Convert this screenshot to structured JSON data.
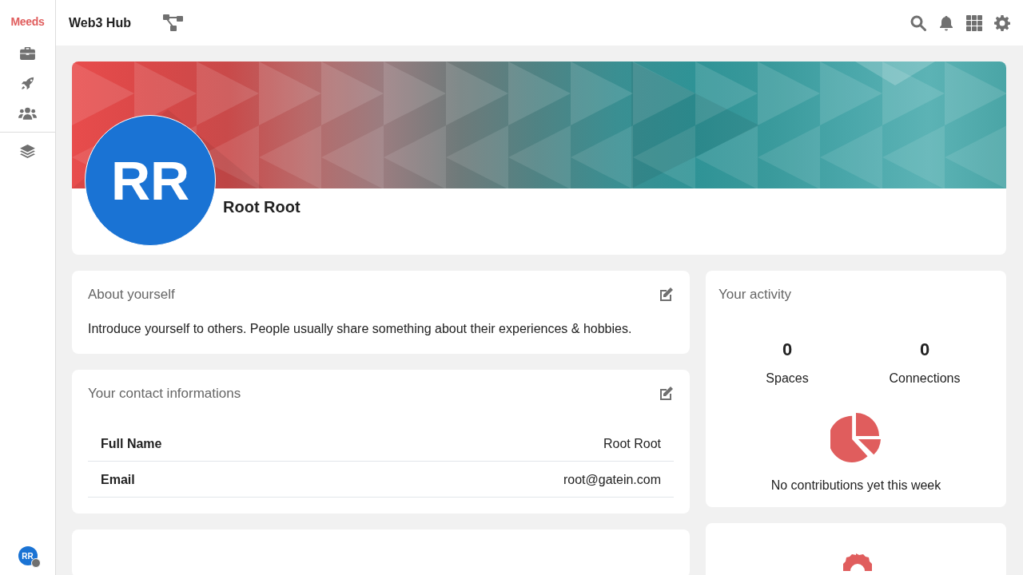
{
  "sidebar": {
    "logo": "Meeds",
    "avatar_initials": "RR"
  },
  "topbar": {
    "title": "Web3 Hub"
  },
  "profile": {
    "initials": "RR",
    "name": "Root Root"
  },
  "about": {
    "title": "About yourself",
    "text": "Introduce yourself to others. People usually share something about their experiences & hobbies."
  },
  "contact": {
    "title": "Your contact informations",
    "fields": [
      {
        "label": "Full Name",
        "value": "Root Root"
      },
      {
        "label": "Email",
        "value": "root@gatein.com"
      }
    ]
  },
  "activity": {
    "title": "Your activity",
    "stats": [
      {
        "value": "0",
        "label": "Spaces"
      },
      {
        "value": "0",
        "label": "Connections"
      }
    ],
    "empty_text": "No contributions yet this week"
  }
}
